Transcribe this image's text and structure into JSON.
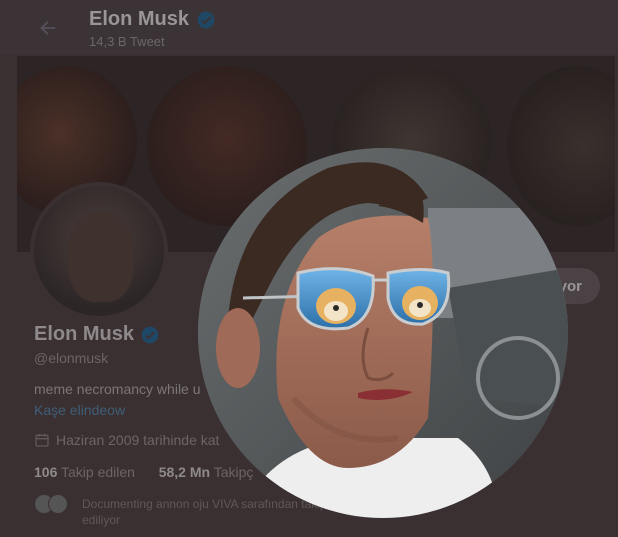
{
  "header": {
    "name": "Elon Musk",
    "tweets_count": "14,3 B Tweet"
  },
  "profile": {
    "name": "Elon Musk",
    "handle": "@elonmusk",
    "bio": "meme necromancy while u",
    "bio_link": "Kaşe elindeow",
    "joined": "Haziran 2009 tarihinde kat",
    "following_count": "106",
    "following_label": "Takip edilen",
    "followers_count": "58,2 Mn",
    "followers_label": "Takipç",
    "followed_by": "Documenting annon oju VIVA sarafından takip",
    "followed_by_line2": "ediliyor",
    "follow_button": "yor"
  },
  "icons": {
    "back": "back-arrow-icon",
    "verified": "verified-badge-icon",
    "calendar": "calendar-icon"
  },
  "colors": {
    "overlay": "#3a3032",
    "verified_badge": "#1d9bf0"
  }
}
